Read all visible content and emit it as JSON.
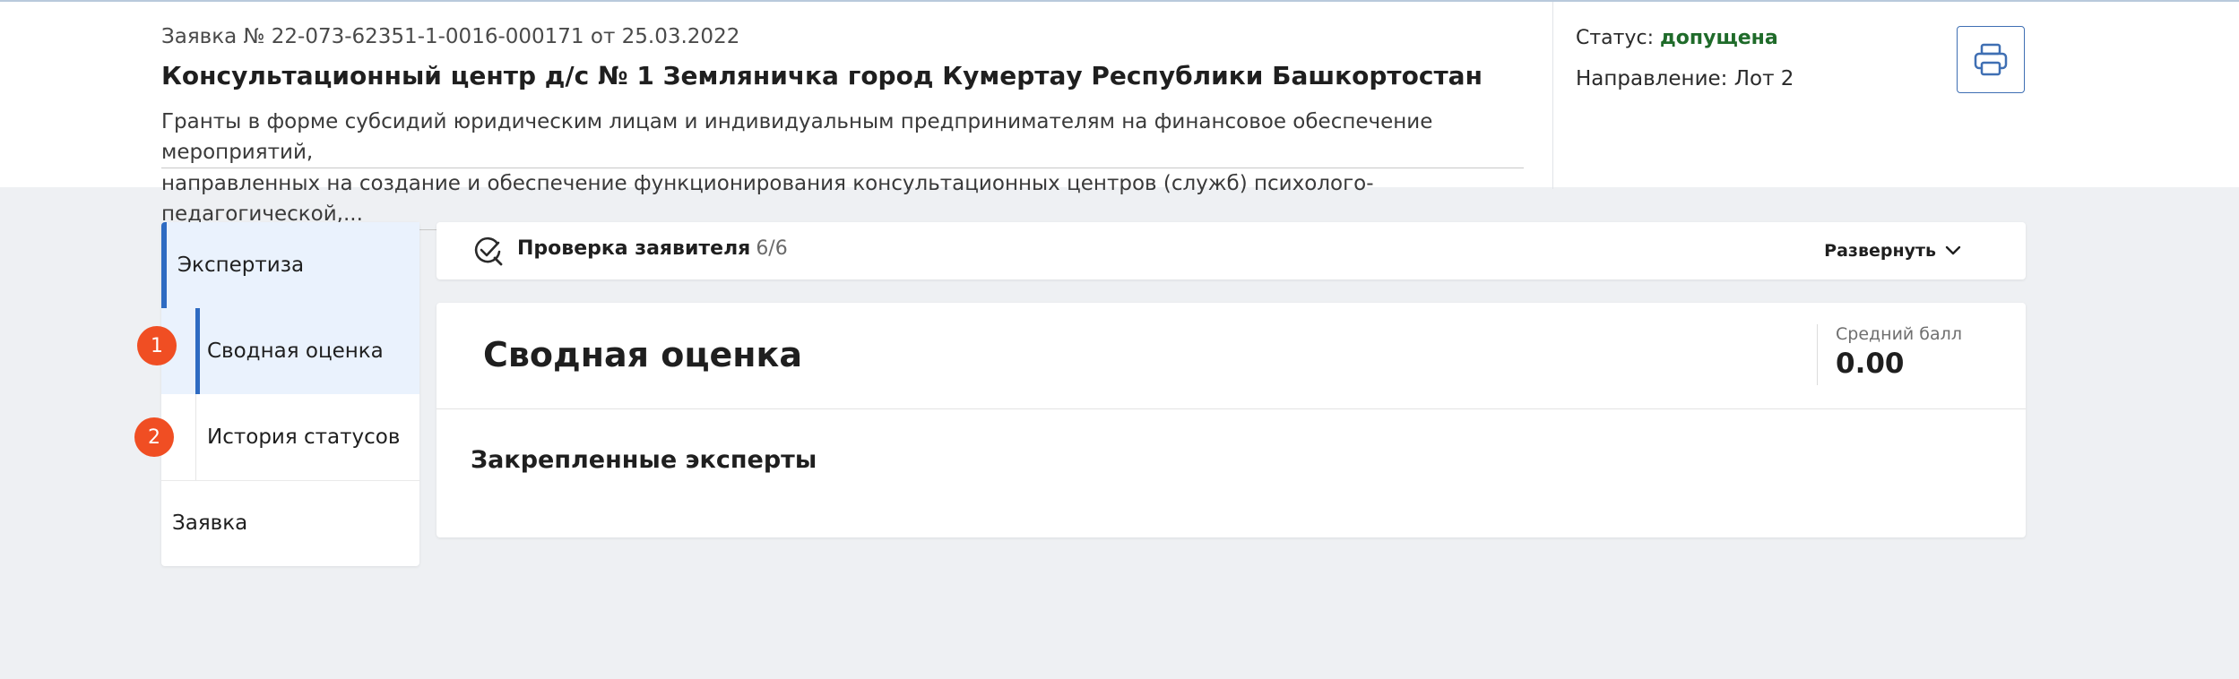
{
  "header": {
    "application_number": "Заявка № 22-073-62351-1-0016-000171 от 25.03.2022",
    "org_title": "Консультационный центр д/с № 1 Земляничка город Кумертау Республики Башкортостан",
    "grant_line1": "Гранты в форме субсидий юридическим лицам и индивидуальным предпринимателям на финансовое обеспечение мероприятий,",
    "grant_line2": "направленных на создание и обеспечение функционирования консультационных центров (служб) психолого-педагогической,...",
    "status_label": "Статус:",
    "status_value": "допущена",
    "status_color": "#1f6b2a",
    "direction": "Направление: Лот 2",
    "print_icon": "printer-icon"
  },
  "sidebar": {
    "items": [
      {
        "label": "Экспертиза"
      },
      {
        "label": "Сводная оценка",
        "badge": "1"
      },
      {
        "label": "История статусов",
        "badge": "2"
      },
      {
        "label": "Заявка"
      }
    ]
  },
  "check_panel": {
    "icon": "check-search-icon",
    "title": "Проверка заявителя",
    "count": "6/6",
    "expand_label": "Развернуть"
  },
  "main": {
    "title": "Сводная оценка",
    "avg_label": "Средний балл",
    "avg_value": "0.00",
    "experts_title": "Закрепленные эксперты"
  },
  "colors": {
    "accent": "#2e6bc2",
    "badge": "#f04e23",
    "active_bg": "#eaf2fd"
  }
}
